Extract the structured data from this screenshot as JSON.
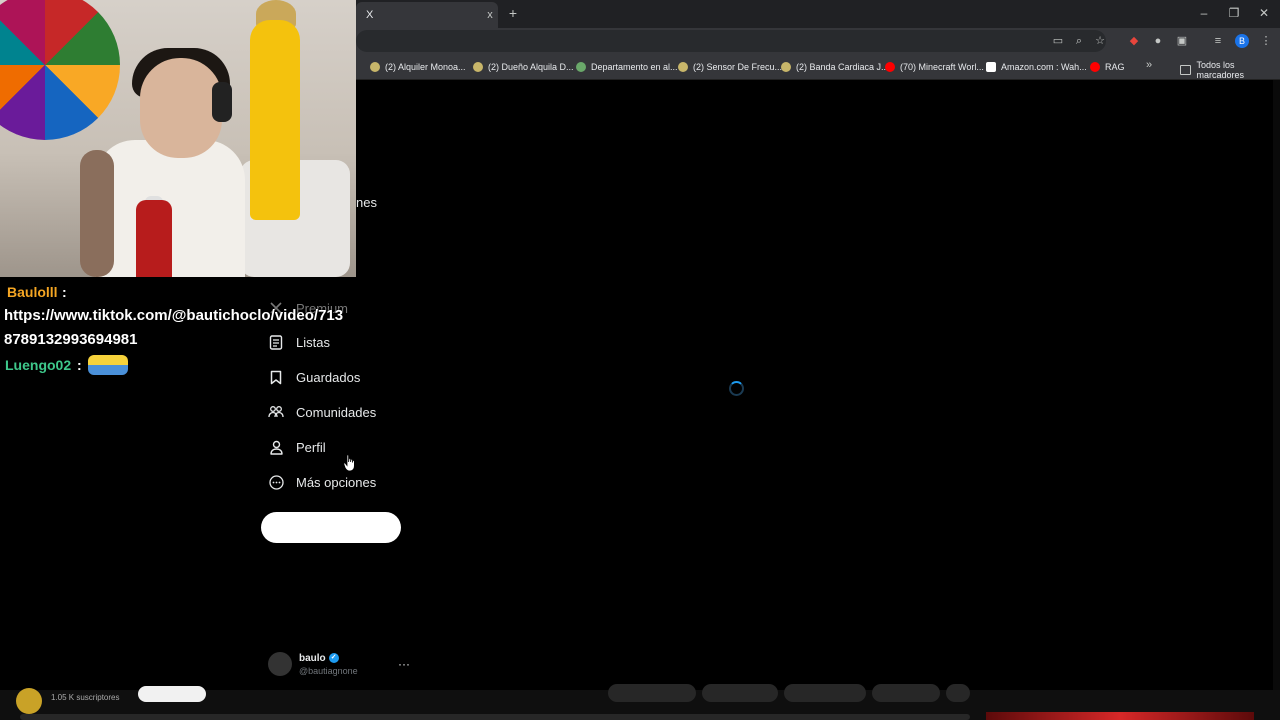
{
  "browser": {
    "tab_title": "X",
    "tab_close": "x",
    "new_tab": "+",
    "window_controls": {
      "minimize": "–",
      "restore": "❐",
      "close": "✕"
    },
    "profile_initial": "B",
    "bookmarks": [
      {
        "label": "(2) Alquiler Monoa...",
        "color": "#c8b66a"
      },
      {
        "label": "(2) Dueño Alquila D...",
        "color": "#c8b66a"
      },
      {
        "label": "Departamento en al...",
        "color": "#6aa86a"
      },
      {
        "label": "(2) Sensor De Frecu...",
        "color": "#c8b66a"
      },
      {
        "label": "(2) Banda Cardiaca J...",
        "color": "#c8b66a"
      },
      {
        "label": "(70) Minecraft Worl...",
        "color": "#ff0000"
      },
      {
        "label": "Amazon.com : Wah...",
        "color": "#ffffff"
      },
      {
        "label": "RAG",
        "color": "#ff0000"
      }
    ],
    "bookmarks_more": "»",
    "all_bookmarks": "Todos los marcadores"
  },
  "chat": {
    "user1": "Baulolll",
    "colon": ":",
    "message1": "https://www.tiktok.com/@bautichoclo/video/7138789132993694981",
    "user2": "Luengo02"
  },
  "x_nav": {
    "partial_label": "nes",
    "premium": "Premium",
    "items": [
      {
        "label": "Listas",
        "icon": "list-icon"
      },
      {
        "label": "Guardados",
        "icon": "bookmark-icon"
      },
      {
        "label": "Comunidades",
        "icon": "communities-icon"
      },
      {
        "label": "Perfil",
        "icon": "profile-icon"
      },
      {
        "label": "Más opciones",
        "icon": "more-options-icon"
      }
    ]
  },
  "account": {
    "name": "baulo",
    "handle": "@bautiagnone",
    "more": "···"
  },
  "youtube": {
    "subscribers": "1.05 K suscriptores"
  }
}
